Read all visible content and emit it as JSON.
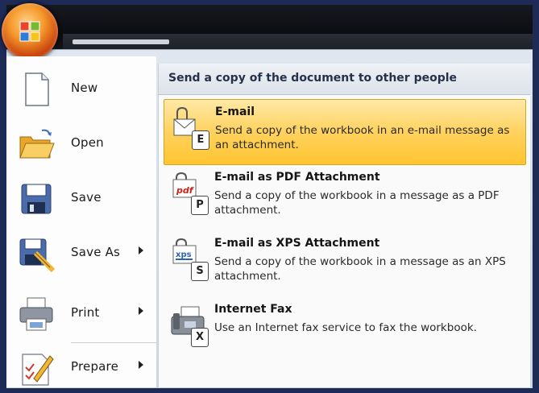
{
  "left_menu": {
    "items": [
      {
        "label": "New"
      },
      {
        "label": "Open"
      },
      {
        "label": "Save"
      },
      {
        "label": "Save As"
      },
      {
        "label": "Print"
      },
      {
        "label": "Prepare"
      }
    ]
  },
  "send_panel": {
    "header": "Send a copy of the document to other people",
    "options": [
      {
        "title": "E-mail",
        "description": "Send a copy of the workbook in an e-mail message as an attachment.",
        "badge": "E",
        "selected": true
      },
      {
        "title": "E-mail as PDF Attachment",
        "description": "Send a copy of the workbook in a message as a PDF attachment.",
        "badge": "P",
        "icon_caption": "pdf"
      },
      {
        "title": "E-mail as XPS Attachment",
        "description": "Send a copy of the workbook in a message as an XPS attachment.",
        "badge": "S",
        "icon_caption": "xps"
      },
      {
        "title": "Internet Fax",
        "description": "Use an Internet fax service to fax the workbook.",
        "badge": "X"
      }
    ]
  },
  "colors": {
    "highlight": "#ffd25e",
    "orb": "#f59a2d",
    "pane_background": "#fafafa"
  }
}
